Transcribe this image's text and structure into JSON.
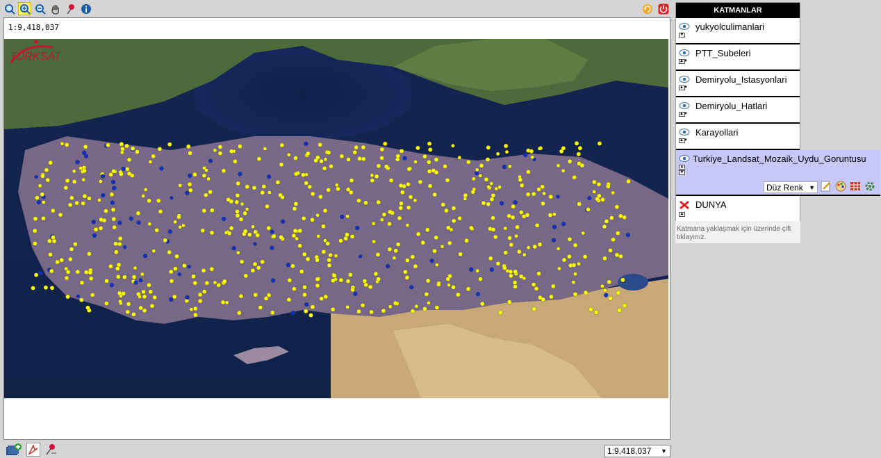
{
  "map": {
    "scale_label": "1:9,418,037"
  },
  "layers_panel": {
    "title": "KATMANLAR",
    "layers": [
      {
        "name": "yukyolculimanlari",
        "visible": true
      },
      {
        "name": "PTT_Subeleri",
        "visible": true
      },
      {
        "name": "Demiryolu_Istasyonlari",
        "visible": true
      },
      {
        "name": "Demiryolu_Hatlari",
        "visible": true
      },
      {
        "name": "Karayollari",
        "visible": true
      },
      {
        "name": "Turkiye_Landsat_Mozaik_Uydu_Goruntusu",
        "visible": true,
        "selected": true
      },
      {
        "name": "DUNYA",
        "visible": false
      }
    ],
    "style_option": "Düz Renk",
    "hint": "Katmana yaklaşmak için üzerinde çift tıklayınız."
  },
  "scale_selector": {
    "value": "1:9,418,037"
  },
  "colors": {
    "point": "#ffff00",
    "header_bg": "#000000",
    "selected_layer_bg": "#c8c8f8"
  },
  "icons": {
    "toolbar": [
      "zoom-full-icon",
      "zoom-in-icon",
      "zoom-out-icon",
      "pan-hand-icon",
      "pin-icon",
      "info-icon"
    ],
    "top_right": [
      "refresh-icon",
      "power-icon"
    ],
    "bottom_left": [
      "add-layer-icon",
      "pdf-icon",
      "pin-icon"
    ]
  }
}
